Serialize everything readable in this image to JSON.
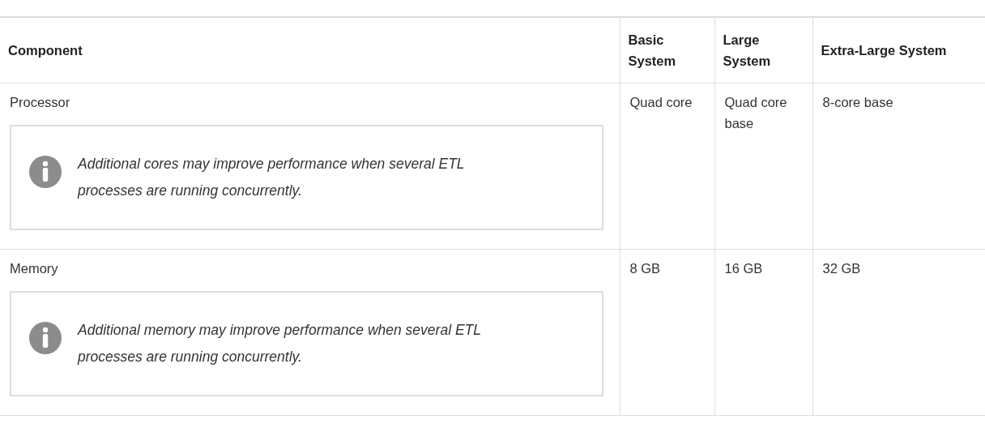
{
  "table": {
    "columns": [
      "Component",
      "Basic System",
      "Large System",
      "Extra-Large System"
    ],
    "rows": [
      {
        "component": "Processor",
        "note": "Additional cores may improve performance when several ETL processes are running concurrently.",
        "values": [
          "Quad core",
          "Quad core base",
          "8-core base"
        ]
      },
      {
        "component": "Memory",
        "note": "Additional memory may improve performance when several ETL processes are running concurrently.",
        "values": [
          "8 GB",
          "16 GB",
          "32 GB"
        ]
      }
    ]
  }
}
